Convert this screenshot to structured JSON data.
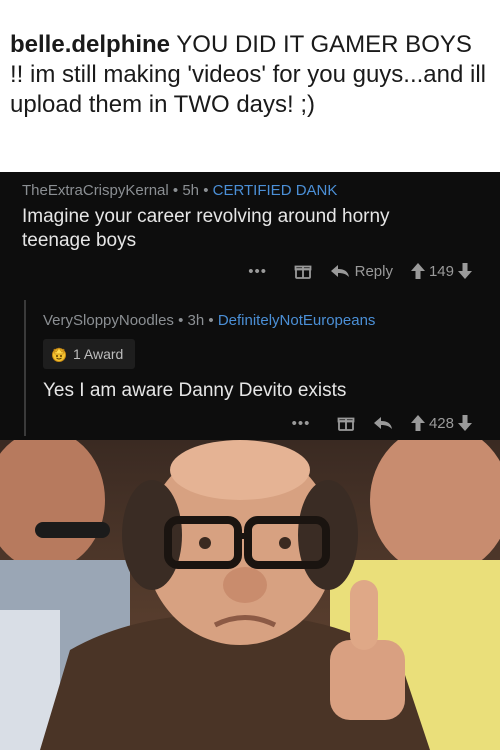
{
  "caption": {
    "username": "belle.delphine",
    "text": "YOU DID IT GAMER BOYS !! im still making 'videos' for you guys...and ill upload them in TWO days! ;)"
  },
  "comment1": {
    "author": "TheExtraCrispyKernal",
    "time": "5h",
    "flair": "CERTIFIED DANK",
    "body": "Imagine your career revolving around horny teenage boys",
    "dots": "•••",
    "reply": "Reply",
    "score": "149"
  },
  "comment2": {
    "author": "VerySloppyNoodles",
    "time": "3h",
    "flair": "DefinitelyNotEuropeans",
    "award": "1 Award",
    "body": "Yes I am aware Danny Devito exists",
    "dots": "•••",
    "score": "428"
  },
  "separator": "•",
  "icons": [
    "gift-icon",
    "reply-arrow-icon",
    "upvote-icon",
    "downvote-icon",
    "award-icon"
  ],
  "colors": {
    "background_dark": "#0d0d0d",
    "flair_blue": "#4b8fd6",
    "meta_gray": "#8b8f93"
  }
}
